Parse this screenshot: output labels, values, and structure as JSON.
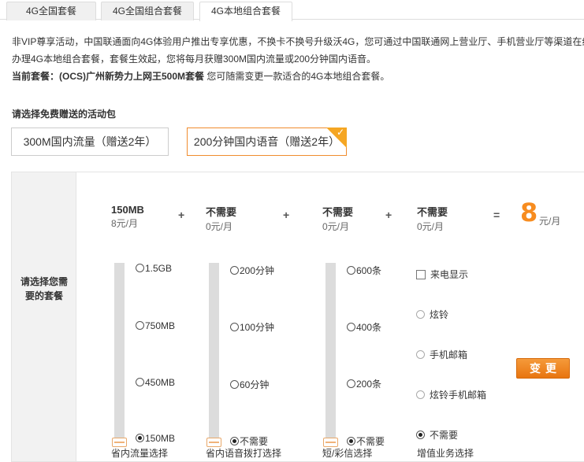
{
  "tabs": [
    "4G全国套餐",
    "4G全国组合套餐",
    "4G本地组合套餐"
  ],
  "active_tab": 2,
  "description": {
    "line1": "非VIP尊享活动，中国联通面向4G体验用户推出专享优惠，不换卡不换号升级沃4G，您可通过中国联通网上营业厅、手机营业厅等渠道在线",
    "line2": "办理4G本地组合套餐，套餐生效起，您将每月获赠300M国内流量或200分钟国内语音。",
    "current_label": "当前套餐：",
    "current_plan": "(OCS)广州新势力上网王500M套餐",
    "current_suffix": "您可随需变更一款适合的4G本地组合套餐。"
  },
  "gift": {
    "title": "请选择免费赠送的活动包",
    "options": [
      "300M国内流量（赠送2年）",
      "200分钟国内语音（赠送2年）"
    ],
    "selected": 1,
    "check": "✓"
  },
  "package": {
    "left_label": "请选择您需要的套餐",
    "columns": [
      {
        "name": "150MB",
        "price": "8元/月",
        "stops": [
          "1.5GB",
          "750MB",
          "450MB",
          "150MB"
        ],
        "selected": 3,
        "footer": "省内流量选择"
      },
      {
        "name": "不需要",
        "price": "0元/月",
        "stops": [
          "200分钟",
          "100分钟",
          "60分钟",
          "不需要"
        ],
        "selected": 3,
        "footer": "省内语音拨打选择"
      },
      {
        "name": "不需要",
        "price": "0元/月",
        "stops": [
          "600条",
          "400条",
          "200条",
          "不需要"
        ],
        "selected": 3,
        "footer": "短/彩信选择"
      },
      {
        "name": "不需要",
        "price": "0元/月",
        "footer": "增值业务选择"
      }
    ],
    "operators": [
      "+",
      "+",
      "+",
      "="
    ],
    "total": "8",
    "total_unit": "元/月",
    "vas": {
      "checkbox_label": "来电显示",
      "radios": [
        "炫铃",
        "手机邮箱",
        "炫铃手机邮箱",
        "不需要"
      ],
      "selected": 3
    },
    "change_button": "变更"
  }
}
